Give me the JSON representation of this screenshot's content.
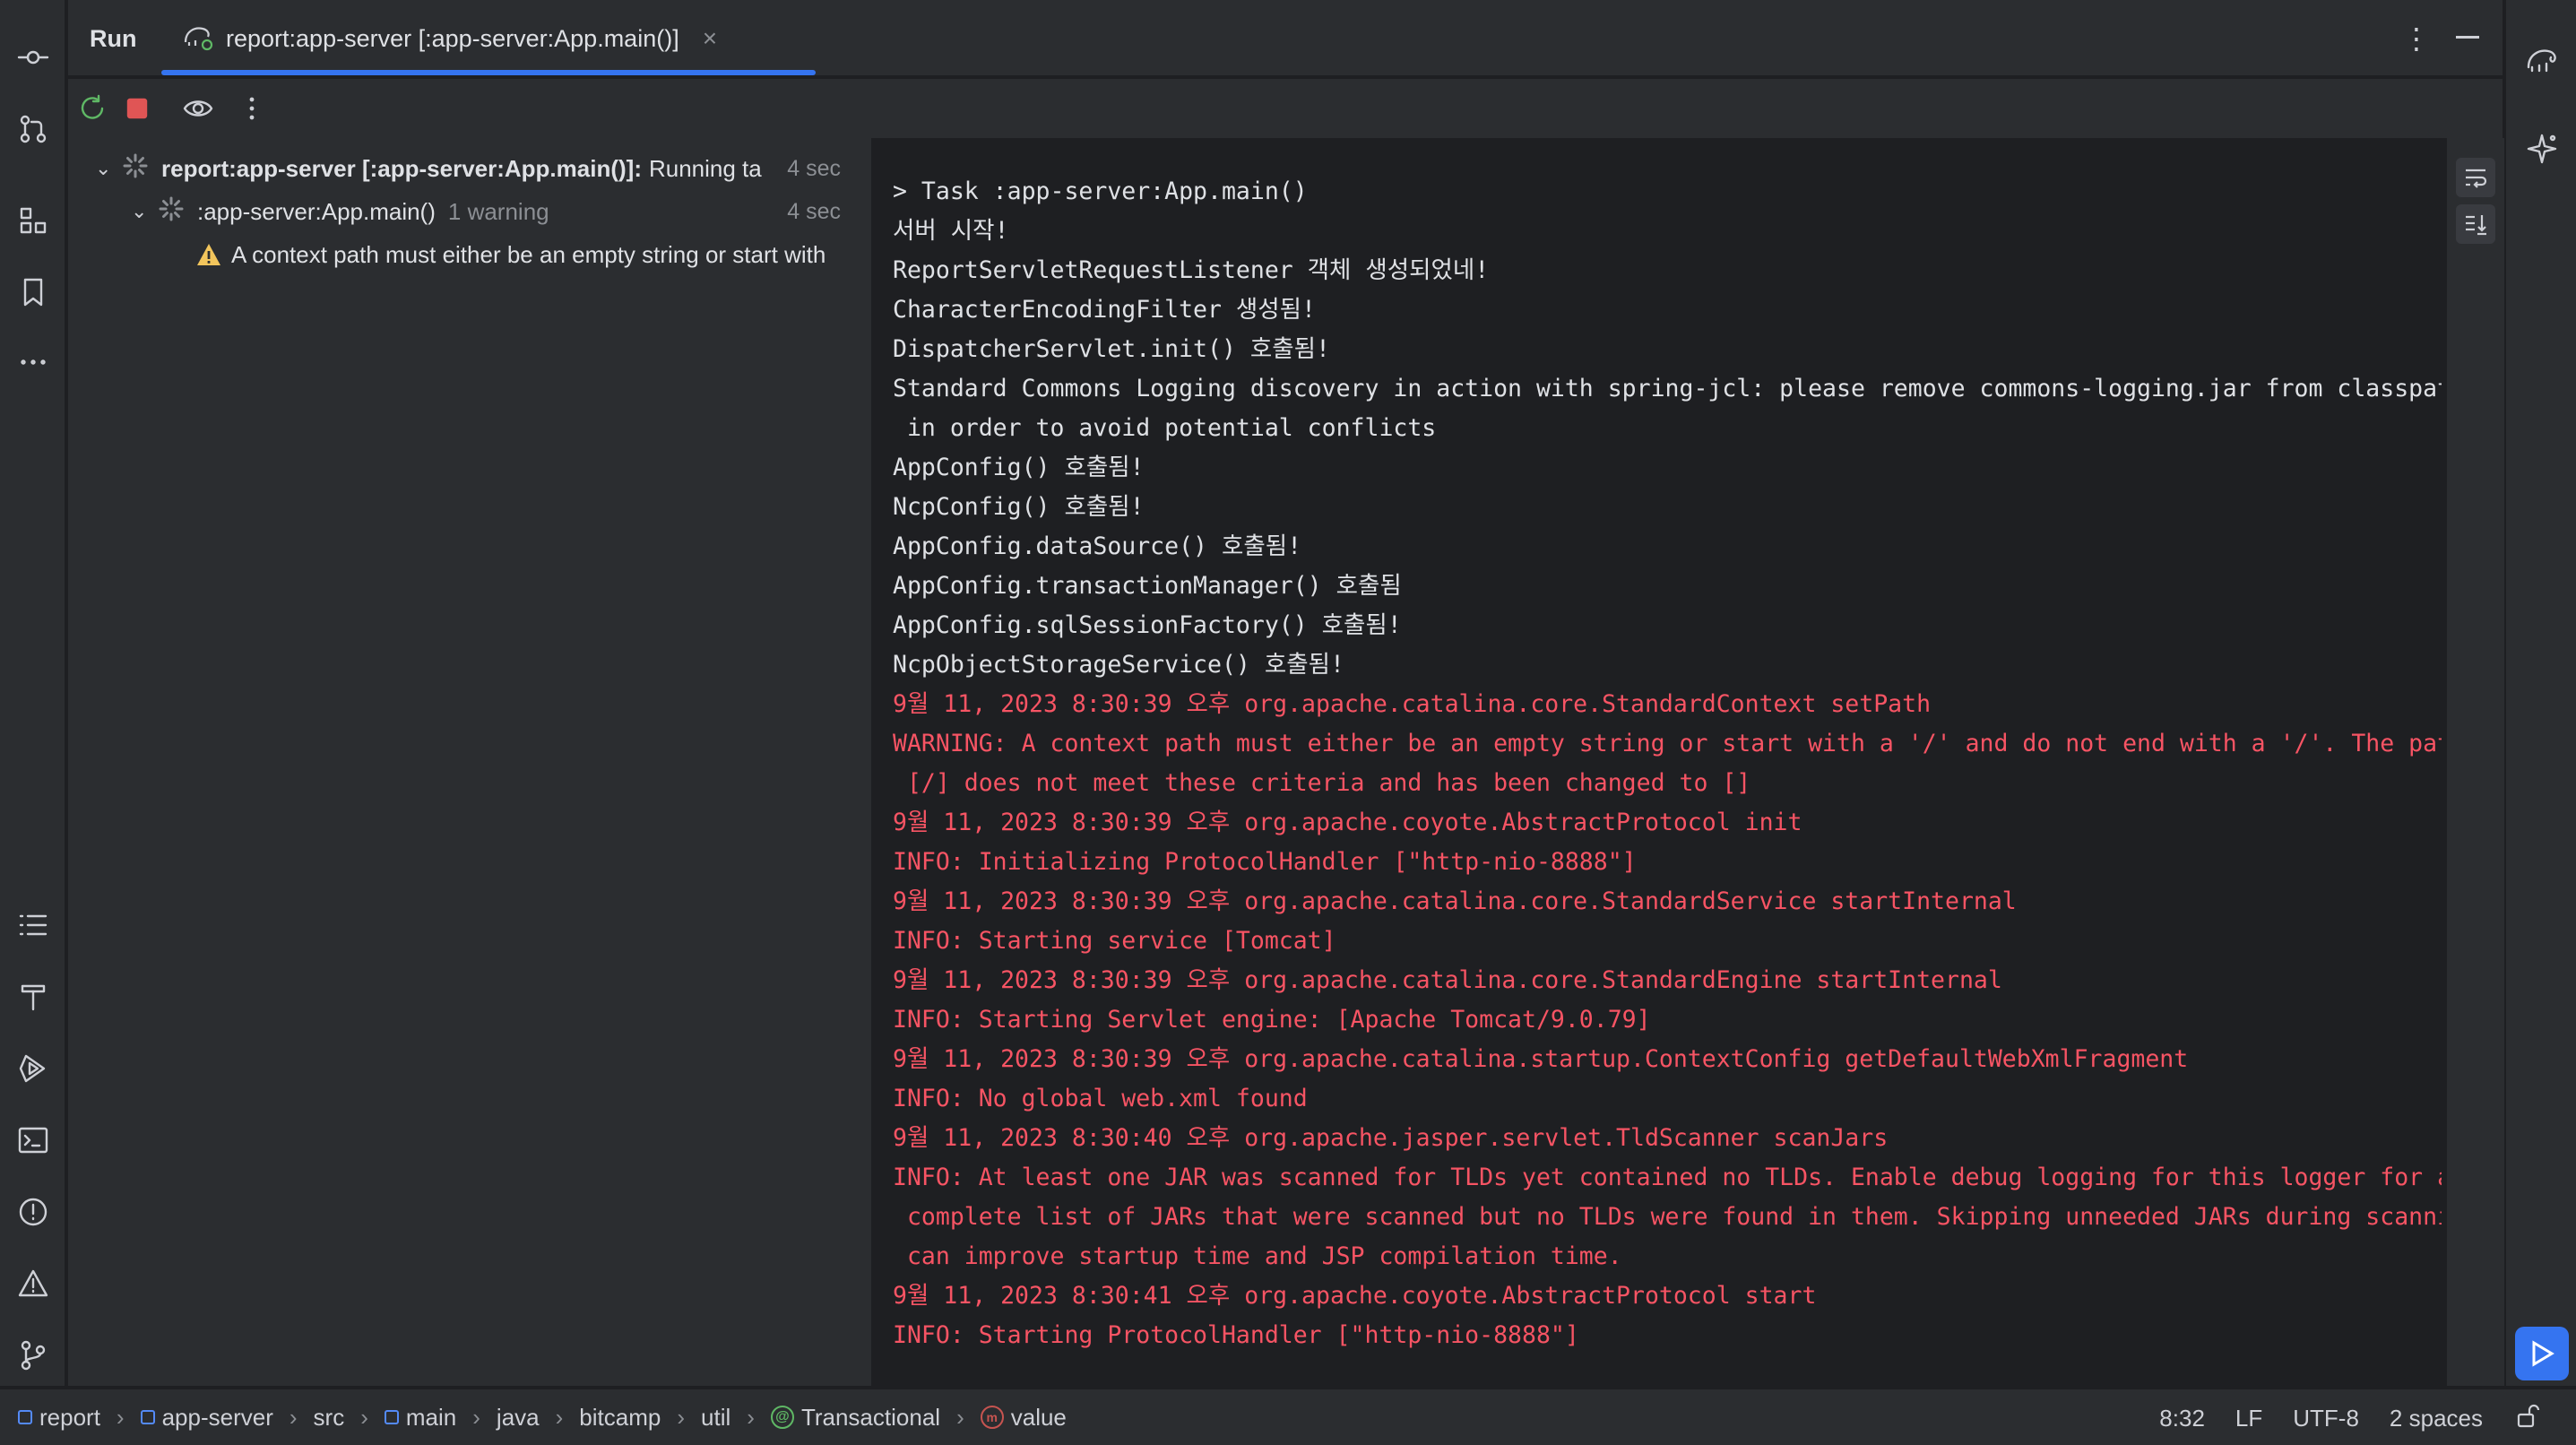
{
  "colors": {
    "accent": "#3574f0",
    "error_text": "#f75464",
    "warning": "#f2c55c"
  },
  "tool_window": {
    "title": "Run",
    "tab_label": "report:app-server [:app-server:App.main()]",
    "tab_close": "×"
  },
  "tree": {
    "root": {
      "label": "report:app-server [:app-server:App.main()]:",
      "status": "Running ta",
      "time": "4 sec"
    },
    "child": {
      "label": ":app-server:App.main()",
      "status": "1 warning",
      "time": "4 sec"
    },
    "warning": {
      "label": "A context path must either be an empty string or start with"
    }
  },
  "console": {
    "lines": [
      {
        "text": "> Task :app-server:App.main()",
        "type": "normal"
      },
      {
        "text": "서버 시작!",
        "type": "normal"
      },
      {
        "text": "ReportServletRequestListener 객체 생성되었네!",
        "type": "normal"
      },
      {
        "text": "CharacterEncodingFilter 생성됨!",
        "type": "normal"
      },
      {
        "text": "DispatcherServlet.init() 호출됨!",
        "type": "normal"
      },
      {
        "text": "Standard Commons Logging discovery in action with spring-jcl: please remove commons-logging.jar from classpath",
        "type": "normal"
      },
      {
        "text": " in order to avoid potential conflicts",
        "type": "normal"
      },
      {
        "text": "AppConfig() 호출됨!",
        "type": "normal"
      },
      {
        "text": "NcpConfig() 호출됨!",
        "type": "normal"
      },
      {
        "text": "AppConfig.dataSource() 호출됨!",
        "type": "normal"
      },
      {
        "text": "AppConfig.transactionManager() 호출됨",
        "type": "normal"
      },
      {
        "text": "AppConfig.sqlSessionFactory() 호출됨!",
        "type": "normal"
      },
      {
        "text": "NcpObjectStorageService() 호출됨!",
        "type": "normal"
      },
      {
        "text": "9월 11, 2023 8:30:39 오후 org.apache.catalina.core.StandardContext setPath",
        "type": "err"
      },
      {
        "text": "WARNING: A context path must either be an empty string or start with a '/' and do not end with a '/'. The path",
        "type": "err"
      },
      {
        "text": " [/] does not meet these criteria and has been changed to []",
        "type": "err"
      },
      {
        "text": "9월 11, 2023 8:30:39 오후 org.apache.coyote.AbstractProtocol init",
        "type": "err"
      },
      {
        "text": "INFO: Initializing ProtocolHandler [\"http-nio-8888\"]",
        "type": "err"
      },
      {
        "text": "9월 11, 2023 8:30:39 오후 org.apache.catalina.core.StandardService startInternal",
        "type": "err"
      },
      {
        "text": "INFO: Starting service [Tomcat]",
        "type": "err"
      },
      {
        "text": "9월 11, 2023 8:30:39 오후 org.apache.catalina.core.StandardEngine startInternal",
        "type": "err"
      },
      {
        "text": "INFO: Starting Servlet engine: [Apache Tomcat/9.0.79]",
        "type": "err"
      },
      {
        "text": "9월 11, 2023 8:30:39 오후 org.apache.catalina.startup.ContextConfig getDefaultWebXmlFragment",
        "type": "err"
      },
      {
        "text": "INFO: No global web.xml found",
        "type": "err"
      },
      {
        "text": "9월 11, 2023 8:30:40 오후 org.apache.jasper.servlet.TldScanner scanJars",
        "type": "err"
      },
      {
        "text": "INFO: At least one JAR was scanned for TLDs yet contained no TLDs. Enable debug logging for this logger for a",
        "type": "err"
      },
      {
        "text": " complete list of JARs that were scanned but no TLDs were found in them. Skipping unneeded JARs during scanning",
        "type": "err"
      },
      {
        "text": " can improve startup time and JSP compilation time.",
        "type": "err"
      },
      {
        "text": "9월 11, 2023 8:30:41 오후 org.apache.coyote.AbstractProtocol start",
        "type": "err"
      },
      {
        "text": "INFO: Starting ProtocolHandler [\"http-nio-8888\"]",
        "type": "err"
      }
    ]
  },
  "status_bar": {
    "breadcrumbs": [
      "report",
      "app-server",
      "src",
      "main",
      "java",
      "bitcamp",
      "util",
      "Transactional",
      "value"
    ],
    "separator": "›",
    "position": "8:32",
    "line_ending": "LF",
    "encoding": "UTF-8",
    "indent": "2 spaces"
  }
}
